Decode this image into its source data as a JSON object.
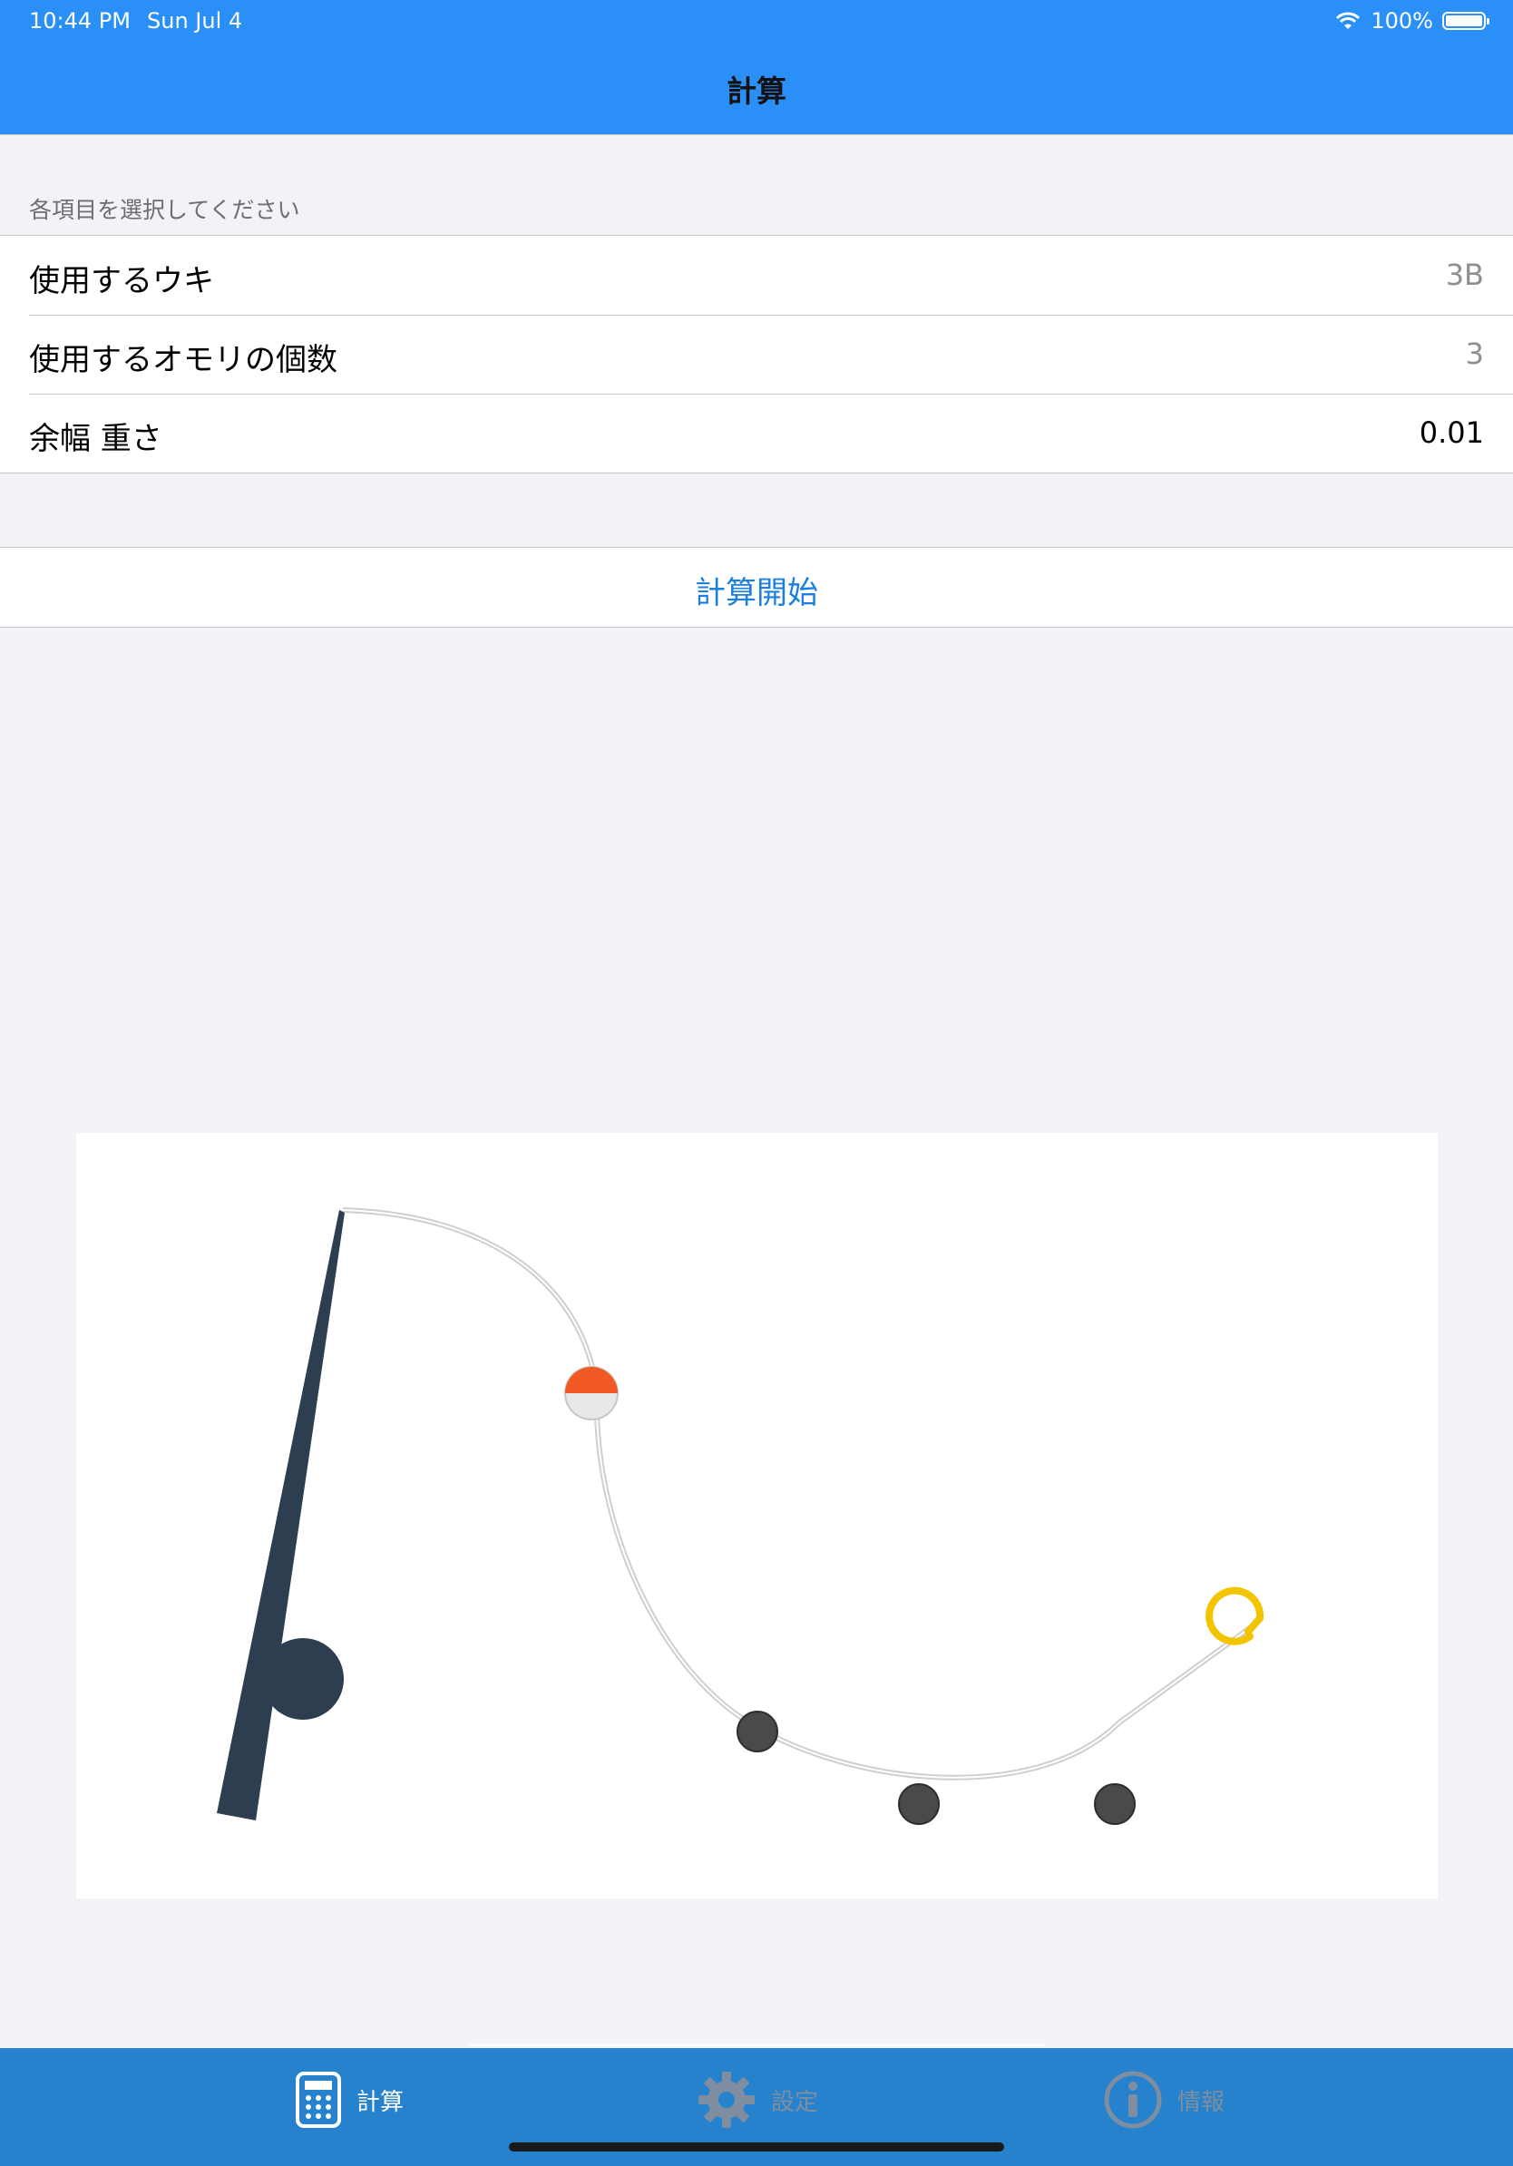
{
  "status_bar": {
    "time": "10:44 PM",
    "date": "Sun Jul 4",
    "battery": "100%"
  },
  "nav": {
    "title": "計算"
  },
  "section_header": "各項目を選択してください",
  "rows": [
    {
      "label": "使用するウキ",
      "value": "3B"
    },
    {
      "label": "使用するオモリの個数",
      "value": "3"
    },
    {
      "label": "余幅 重さ",
      "value": "0.01"
    }
  ],
  "action": {
    "label": "計算開始"
  },
  "tabs": [
    {
      "label": "計算",
      "icon": "calculator-icon",
      "active": true
    },
    {
      "label": "設定",
      "icon": "gear-icon",
      "active": false
    },
    {
      "label": "情報",
      "icon": "info-icon",
      "active": false
    }
  ],
  "colors": {
    "accent": "#2a8ff7",
    "tab_bar": "#2682cc",
    "link": "#1b7fe0",
    "rod": "#2c3e50",
    "float_top": "#f15a24",
    "sinker": "#4a4a4a",
    "hook": "#f2c500"
  }
}
